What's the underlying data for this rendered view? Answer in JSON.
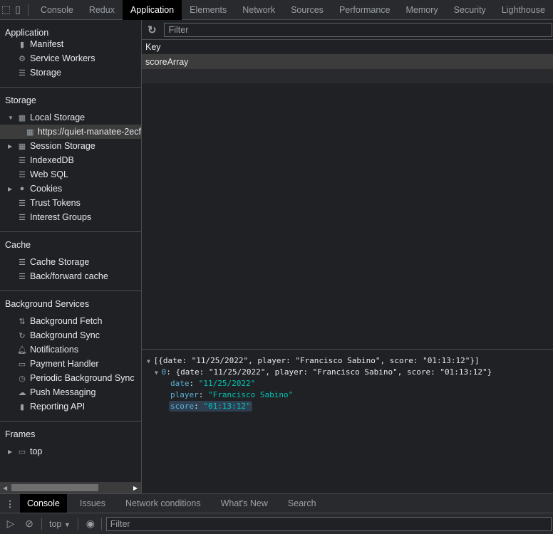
{
  "topbar": {
    "tabs": [
      "Console",
      "Redux",
      "Application",
      "Elements",
      "Network",
      "Sources",
      "Performance",
      "Memory",
      "Security",
      "Lighthouse"
    ],
    "active": "Application"
  },
  "sidebar": {
    "application": {
      "title": "Application",
      "items": [
        "Manifest",
        "Service Workers",
        "Storage"
      ]
    },
    "storage": {
      "title": "Storage",
      "items": [
        "Local Storage",
        "https://quiet-manatee-2ecf",
        "Session Storage",
        "IndexedDB",
        "Web SQL",
        "Cookies",
        "Trust Tokens",
        "Interest Groups"
      ]
    },
    "cache": {
      "title": "Cache",
      "items": [
        "Cache Storage",
        "Back/forward cache"
      ]
    },
    "background": {
      "title": "Background Services",
      "items": [
        "Background Fetch",
        "Background Sync",
        "Notifications",
        "Payment Handler",
        "Periodic Background Sync",
        "Push Messaging",
        "Reporting API"
      ]
    },
    "frames": {
      "title": "Frames",
      "items": [
        "top"
      ]
    }
  },
  "main": {
    "filter_placeholder": "Filter",
    "key_header": "Key",
    "rows": [
      "scoreArray"
    ]
  },
  "preview": {
    "line1": "[{date: \"11/25/2022\", player: \"Francisco Sabino\", score: \"01:13:12\"}]",
    "line2_key": "0",
    "line2": "{date: \"11/25/2022\", player: \"Francisco Sabino\", score: \"01:13:12\"}",
    "date_key": "date",
    "date_val": "\"11/25/2022\"",
    "player_key": "player",
    "player_val": "\"Francisco Sabino\"",
    "score_key": "score",
    "score_val": "\"01:13:12\""
  },
  "drawer": {
    "tabs": [
      "Console",
      "Issues",
      "Network conditions",
      "What's New",
      "Search"
    ],
    "context": "top",
    "filter_placeholder": "Filter"
  }
}
